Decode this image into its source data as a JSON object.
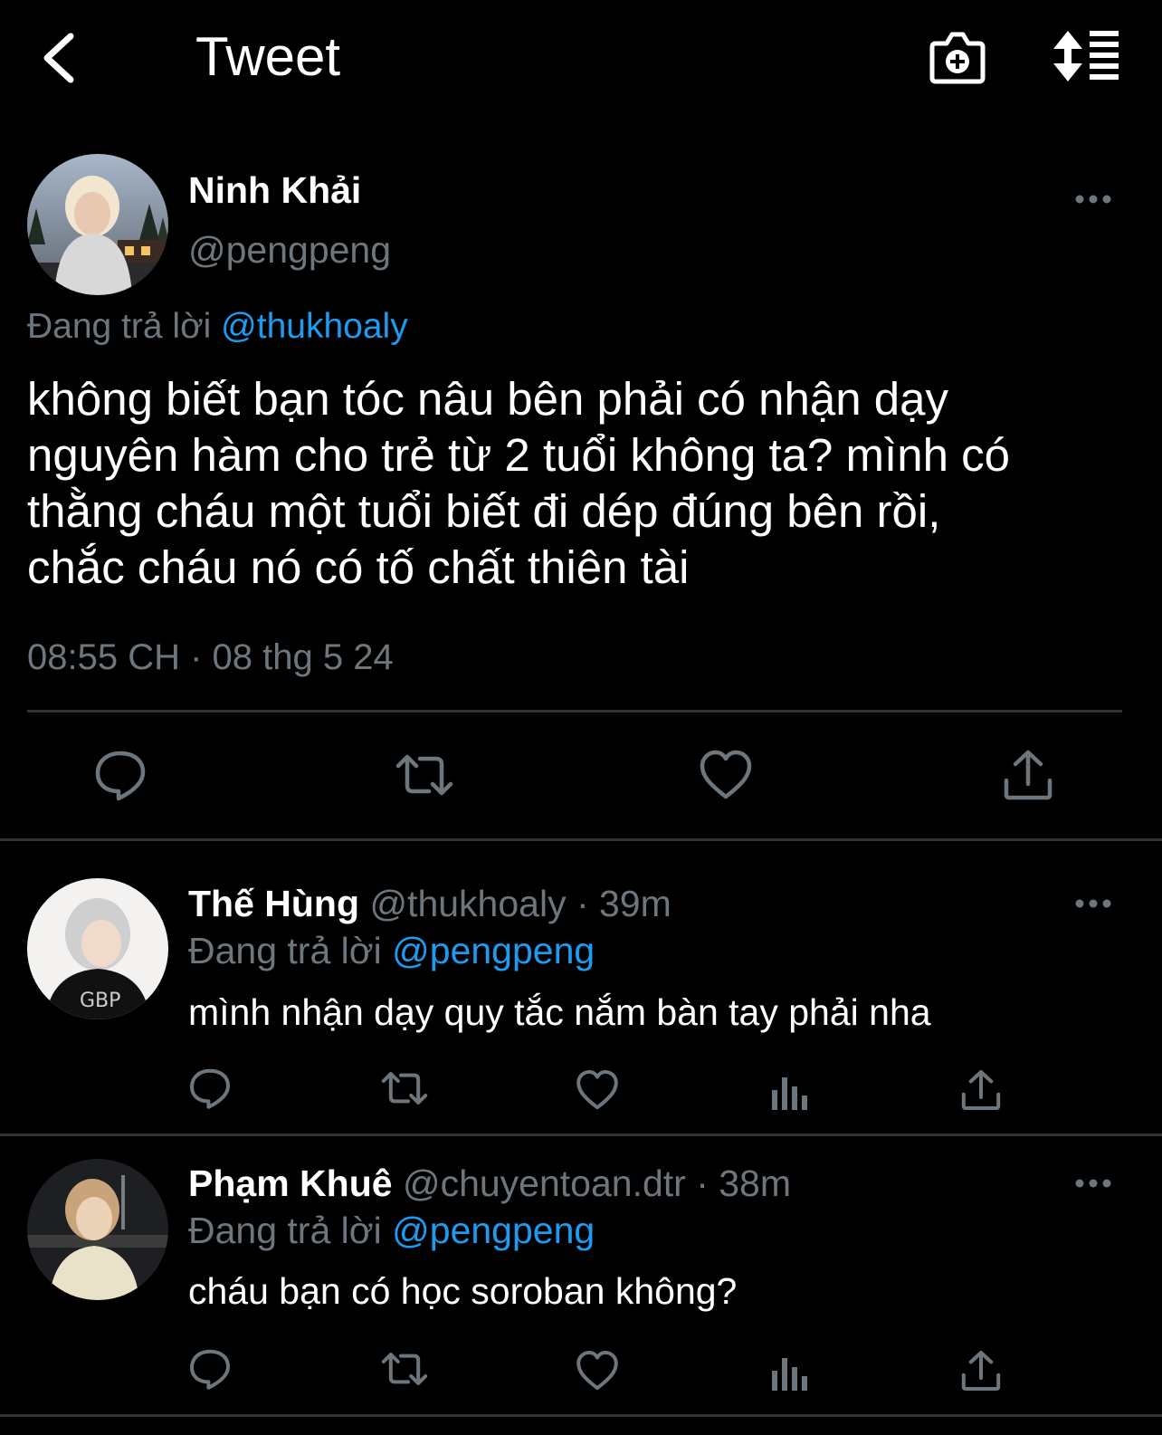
{
  "header": {
    "title": "Tweet"
  },
  "main_tweet": {
    "author_name": "Ninh Khải",
    "author_handle": "@pengpeng",
    "reply_prefix": "Đang trả lời",
    "reply_to": "@thukhoaly",
    "text_lines": [
      "không biết bạn tóc nâu bên phải có nhận dạy",
      "nguyên hàm cho trẻ từ 2 tuổi không ta? mình có",
      "thằng cháu một tuổi biết đi dép đúng bên rồi,",
      "chắc cháu nó có tố chất thiên tài"
    ],
    "timestamp": "08:55 CH · 08 thg 5 24"
  },
  "replies": [
    {
      "author_name": "Thế Hùng",
      "meta": "@thukhoaly · 39m",
      "reply_prefix": "Đang trả lời",
      "reply_to": "@pengpeng",
      "text": "mình nhận dạy quy tắc nắm bàn tay phải nha"
    },
    {
      "author_name": "Phạm Khuê",
      "meta": "@chuyentoan.dtr · 38m",
      "reply_prefix": "Đang trả lời",
      "reply_to": "@pengpeng",
      "text": "cháu bạn có học soroban không?"
    }
  ],
  "icons": {
    "back": "chevron-left-icon",
    "camera": "camera-plus-icon",
    "sort": "sort-lines-icon",
    "reply": "reply-bubble-icon",
    "retweet": "retweet-icon",
    "like": "heart-icon",
    "views": "bar-chart-icon",
    "share": "share-upload-icon",
    "more": "more-dots-icon"
  },
  "colors": {
    "background": "#000000",
    "text": "#e7e9ea",
    "muted": "#6e767d",
    "link": "#1d9bf0",
    "divider": "#2f3336"
  }
}
